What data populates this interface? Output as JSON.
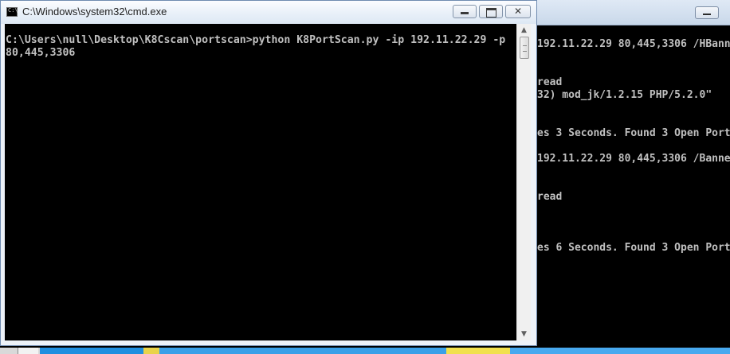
{
  "background_window": {
    "console_lines": [
      {
        "text": "192.11.22.29 80,445,3306 /HBanne",
        "row": 0
      },
      {
        "text": "read",
        "row": 3
      },
      {
        "text": "32) mod_jk/1.2.15 PHP/5.2.0\"",
        "row": 4
      },
      {
        "text": "es 3 Seconds. Found 3 Open Port",
        "row": 7
      },
      {
        "text": "192.11.22.29 80,445,3306 /Banne",
        "row": 9
      },
      {
        "text": "read",
        "row": 12
      },
      {
        "text": "es 6 Seconds. Found 3 Open Port",
        "row": 16
      }
    ]
  },
  "window": {
    "title": "C:\\Windows\\system32\\cmd.exe",
    "icon": "cmd-icon",
    "buttons": {
      "minimize": "minimize-icon",
      "maximize": "maximize-icon",
      "close_glyph": "✕"
    },
    "console_text": "C:\\Users\\null\\Desktop\\K8Cscan\\portscan>python K8PortScan.py -ip 192.11.22.29 -p\n80,445,3306",
    "scrollbar": {
      "up_glyph": "▲",
      "down_glyph": "▼"
    }
  }
}
